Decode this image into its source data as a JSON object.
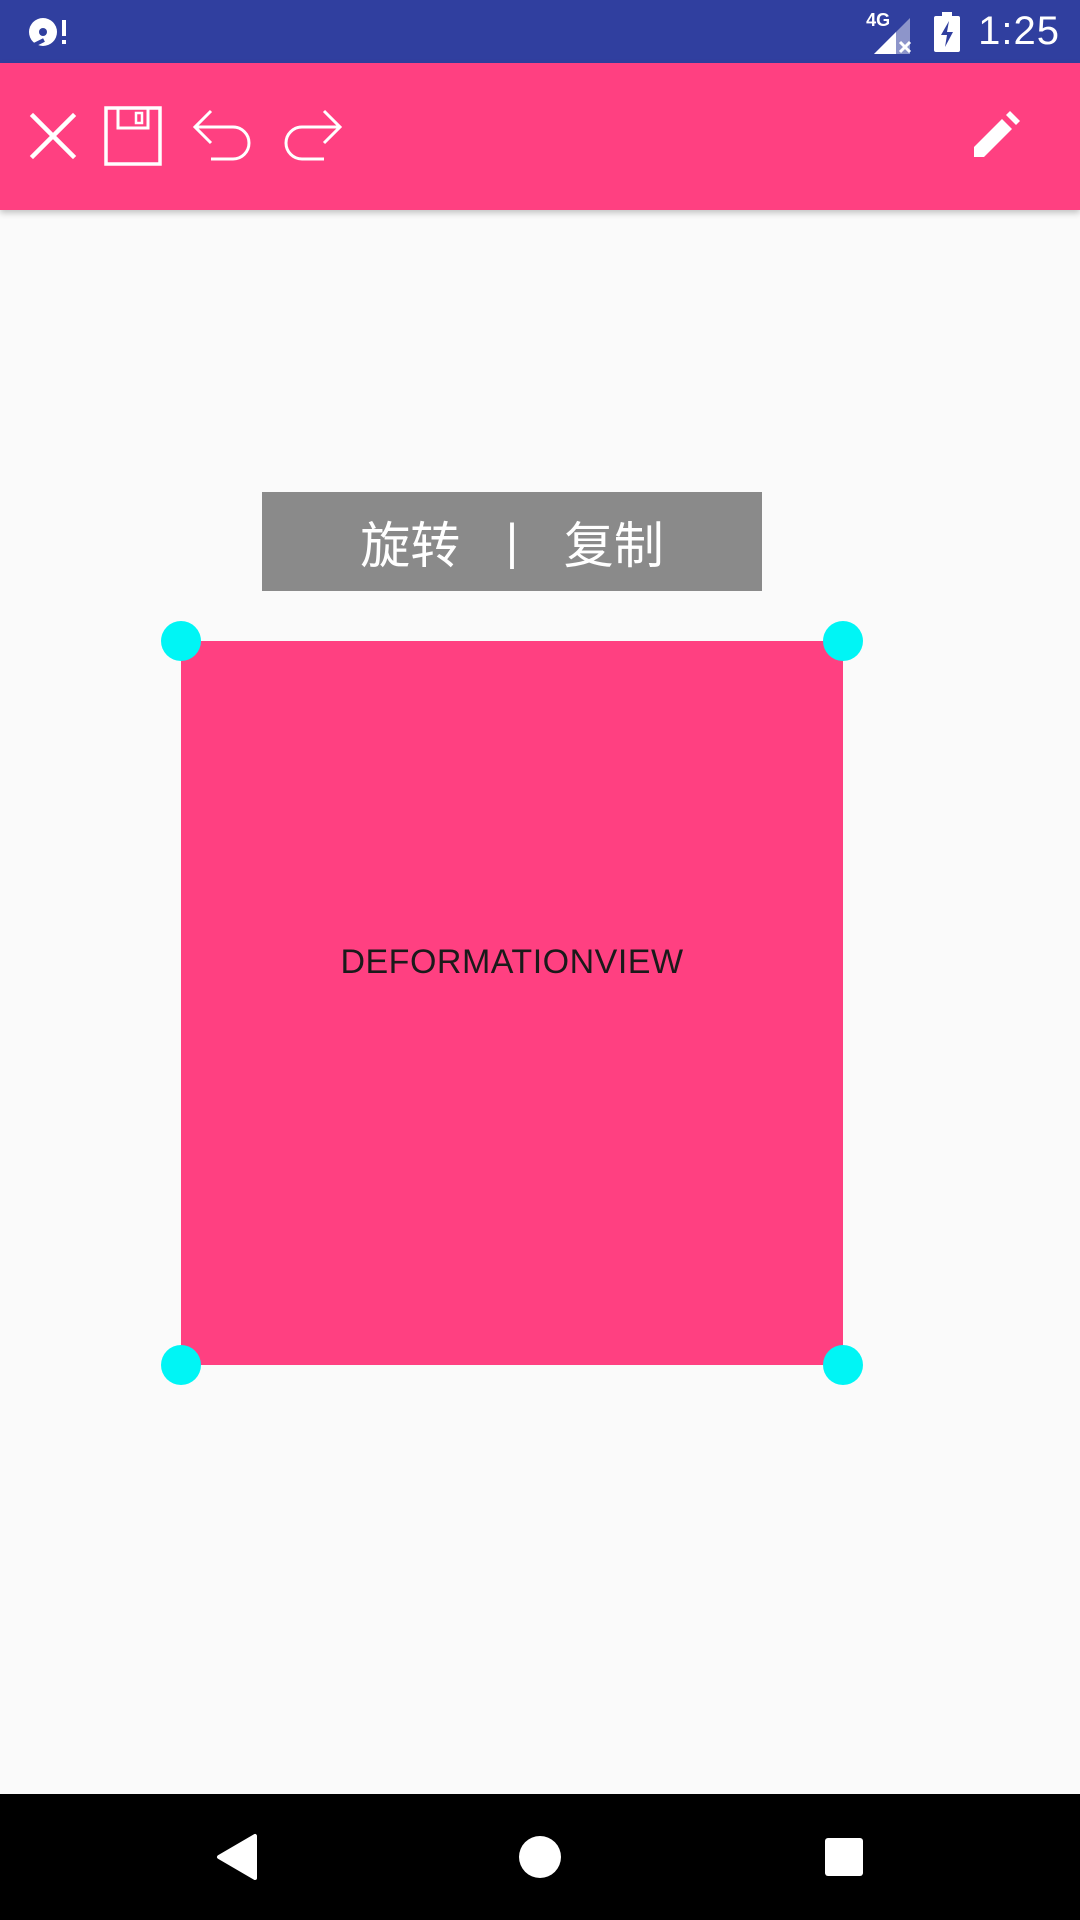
{
  "status_bar": {
    "time": "1:25",
    "network_label": "4G",
    "icons": [
      "disc-alert-icon",
      "signal-no-data-icon",
      "battery-charging-icon"
    ]
  },
  "toolbar": {
    "background": "#FF4081",
    "icons": [
      "close-icon",
      "save-icon",
      "undo-icon",
      "redo-icon",
      "edit-pencil-icon"
    ]
  },
  "popup_menu": {
    "rotate_label": "旋转",
    "separator": "|",
    "copy_label": "复制"
  },
  "deformation_view": {
    "label": "DEFORMATIONVIEW",
    "fill_color": "#FF4081",
    "handle_color": "#00F5F5"
  },
  "nav_bar": {
    "icons": [
      "back-icon",
      "home-icon",
      "recents-icon"
    ]
  }
}
